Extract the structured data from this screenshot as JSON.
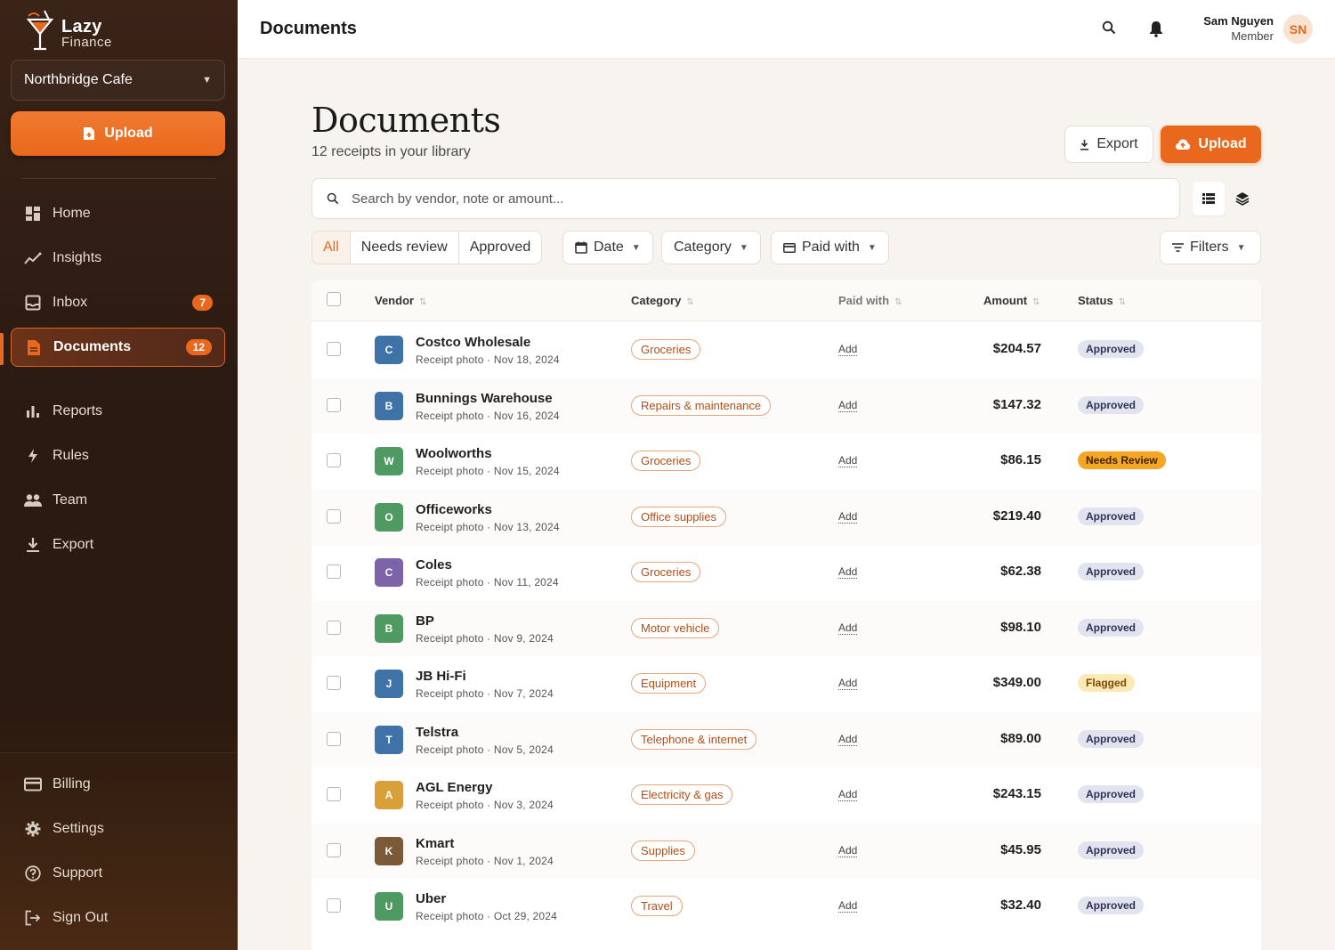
{
  "app": {
    "logo_line1": "Lazy",
    "logo_line2": "Finance",
    "org": "Northbridge Cafe",
    "upload_label": "Upload"
  },
  "sidebar": {
    "items": [
      {
        "label": "Home",
        "icon": "home-icon"
      },
      {
        "label": "Insights",
        "icon": "insights-icon"
      },
      {
        "label": "Inbox",
        "icon": "inbox-icon",
        "badge": "7"
      },
      {
        "label": "Documents",
        "icon": "document-icon",
        "badge": "12",
        "active": true
      },
      {
        "label": "Reports",
        "icon": "bar-chart-icon"
      },
      {
        "label": "Rules",
        "icon": "bolt-icon"
      },
      {
        "label": "Team",
        "icon": "team-icon"
      },
      {
        "label": "Export",
        "icon": "download-icon"
      }
    ],
    "bottom": [
      {
        "label": "Billing",
        "icon": "credit-card-icon"
      },
      {
        "label": "Settings",
        "icon": "gear-icon"
      },
      {
        "label": "Support",
        "icon": "help-icon"
      },
      {
        "label": "Sign Out",
        "icon": "sign-out-icon"
      }
    ]
  },
  "header": {
    "title": "Documents",
    "user_name": "Sam Nguyen",
    "user_role": "Member",
    "user_initials": "SN"
  },
  "main": {
    "title": "Documents",
    "subtitle": "12 receipts in your library",
    "export_label": "Export",
    "upload_label": "Upload",
    "search_placeholder": "Search by vendor, note or amount...",
    "segments": [
      "All",
      "Needs review",
      "Approved"
    ],
    "filters": {
      "date": "Date",
      "category": "Category",
      "paid_with": "Paid with",
      "more": "Filters"
    }
  },
  "table": {
    "columns": {
      "vendor": "Vendor",
      "category": "Category",
      "paid_with": "Paid with",
      "amount": "Amount",
      "status": "Status"
    },
    "rows": [
      {
        "initial": "C",
        "color": "#3f73a8",
        "vendor": "Costco Wholesale",
        "meta": "Receipt photo · Nov 18, 2024",
        "category": "Groceries",
        "paid": "Add",
        "amount": "$204.57",
        "status": "Approved"
      },
      {
        "initial": "B",
        "color": "#3f73a8",
        "vendor": "Bunnings Warehouse",
        "meta": "Receipt photo · Nov 16, 2024",
        "category": "Repairs & maintenance",
        "paid": "Add",
        "amount": "$147.32",
        "status": "Approved"
      },
      {
        "initial": "W",
        "color": "#4f9a62",
        "vendor": "Woolworths",
        "meta": "Receipt photo · Nov 15, 2024",
        "category": "Groceries",
        "paid": "Add",
        "amount": "$86.15",
        "status": "Needs Review"
      },
      {
        "initial": "O",
        "color": "#4f9a62",
        "vendor": "Officeworks",
        "meta": "Receipt photo · Nov 13, 2024",
        "category": "Office supplies",
        "paid": "Add",
        "amount": "$219.40",
        "status": "Approved"
      },
      {
        "initial": "C",
        "color": "#7d64a8",
        "vendor": "Coles",
        "meta": "Receipt photo · Nov 11, 2024",
        "category": "Groceries",
        "paid": "Add",
        "amount": "$62.38",
        "status": "Approved"
      },
      {
        "initial": "B",
        "color": "#4f9a62",
        "vendor": "BP",
        "meta": "Receipt photo · Nov 9, 2024",
        "category": "Motor vehicle",
        "paid": "Add",
        "amount": "$98.10",
        "status": "Approved"
      },
      {
        "initial": "J",
        "color": "#3f73a8",
        "vendor": "JB Hi-Fi",
        "meta": "Receipt photo · Nov 7, 2024",
        "category": "Equipment",
        "paid": "Add",
        "amount": "$349.00",
        "status": "Flagged"
      },
      {
        "initial": "T",
        "color": "#3f73a8",
        "vendor": "Telstra",
        "meta": "Receipt photo · Nov 5, 2024",
        "category": "Telephone & internet",
        "paid": "Add",
        "amount": "$89.00",
        "status": "Approved"
      },
      {
        "initial": "A",
        "color": "#d9a03a",
        "vendor": "AGL Energy",
        "meta": "Receipt photo · Nov 3, 2024",
        "category": "Electricity & gas",
        "paid": "Add",
        "amount": "$243.15",
        "status": "Approved"
      },
      {
        "initial": "K",
        "color": "#7b5a3a",
        "vendor": "Kmart",
        "meta": "Receipt photo · Nov 1, 2024",
        "category": "Supplies",
        "paid": "Add",
        "amount": "$45.95",
        "status": "Approved"
      },
      {
        "initial": "U",
        "color": "#4f9a62",
        "vendor": "Uber",
        "meta": "Receipt photo · Oct 29, 2024",
        "category": "Travel",
        "paid": "Add",
        "amount": "$32.40",
        "status": "Approved"
      }
    ]
  },
  "colors": {
    "accent": "#e9681d",
    "sidebar": "#2a1a12"
  }
}
